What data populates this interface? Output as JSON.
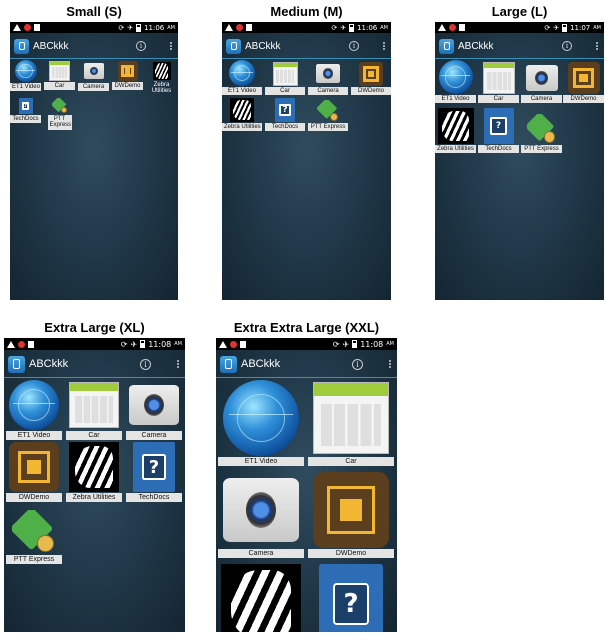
{
  "app_title": "ABCkkk",
  "labels": {
    "et1": "ET1 Video",
    "car": "Car",
    "camera": "Camera",
    "dw": "DWDemo",
    "zebra": "Zebra Utilities",
    "techdocs": "TechDocs",
    "ptt": "PTT Express"
  },
  "panels": [
    {
      "title": "Small (S)",
      "time": "11:06",
      "ampm": "AM"
    },
    {
      "title": "Medium (M)",
      "time": "11:06",
      "ampm": "AM"
    },
    {
      "title": "Large (L)",
      "time": "11:07",
      "ampm": "AM"
    },
    {
      "title": "Extra Large (XL)",
      "time": "11:08",
      "ampm": "AM"
    },
    {
      "title": "Extra Extra Large (XXL)",
      "time": "11:08",
      "ampm": "AM"
    }
  ],
  "status_icons": [
    "warning-icon",
    "record-icon",
    "notification-icon",
    "rotate-icon",
    "airplane-icon",
    "battery-icon"
  ],
  "appbar_icons": [
    "app-logo-icon",
    "info-icon",
    "overflow-menu-icon"
  ],
  "colors": {
    "accent_line": "#3b8fb4",
    "label_bg": "#e4e4e4",
    "status_bar": "#000000"
  }
}
